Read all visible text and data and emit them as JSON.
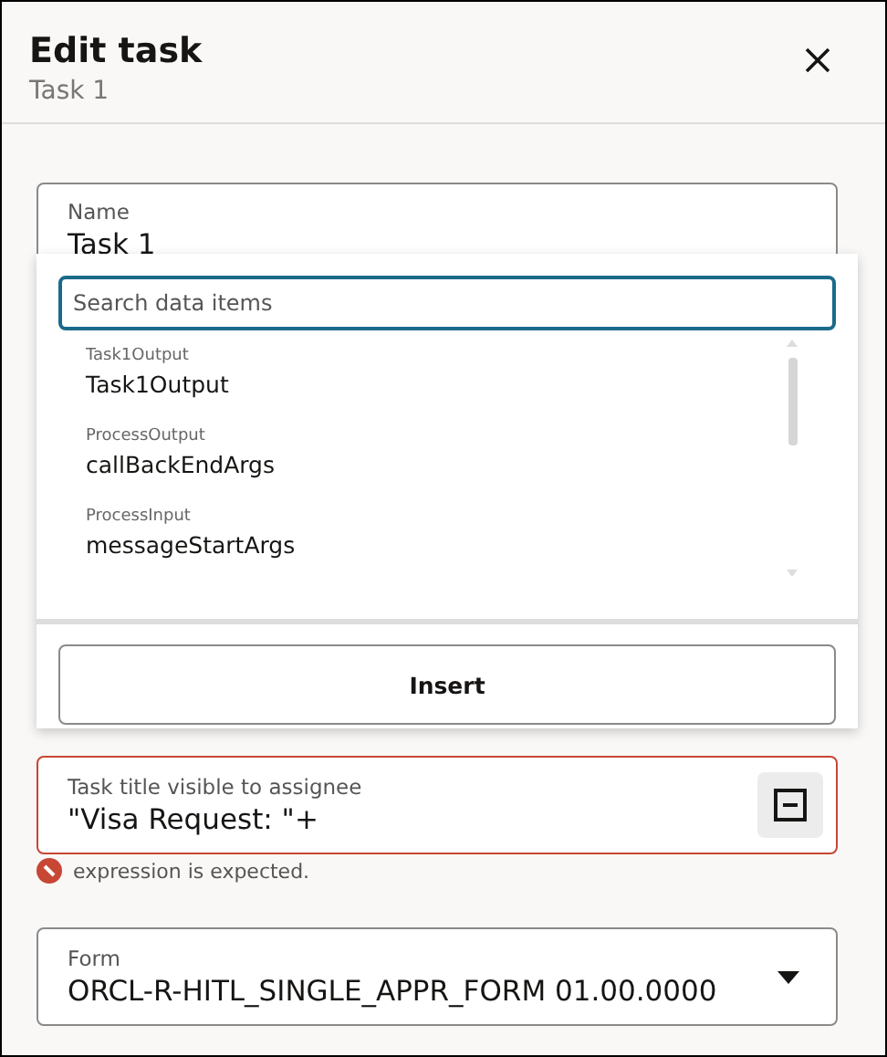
{
  "header": {
    "title": "Edit task",
    "subtitle": "Task 1"
  },
  "name_field": {
    "label": "Name",
    "value": "Task 1"
  },
  "data_popup": {
    "search": {
      "placeholder": "Search data items"
    },
    "items": [
      {
        "category": "Task1Output",
        "name": "Task1Output"
      },
      {
        "category": "ProcessOutput",
        "name": "callBackEndArgs"
      },
      {
        "category": "ProcessInput",
        "name": "messageStartArgs"
      }
    ],
    "insert_button": "Insert"
  },
  "title_field": {
    "label": "Task title visible to assignee",
    "value": "\"Visa Request: \"+",
    "invalid": true,
    "error": "expression is expected."
  },
  "form_field": {
    "label": "Form",
    "value": "ORCL-R-HITL_SINGLE_APPR_FORM 01.00.0000"
  }
}
